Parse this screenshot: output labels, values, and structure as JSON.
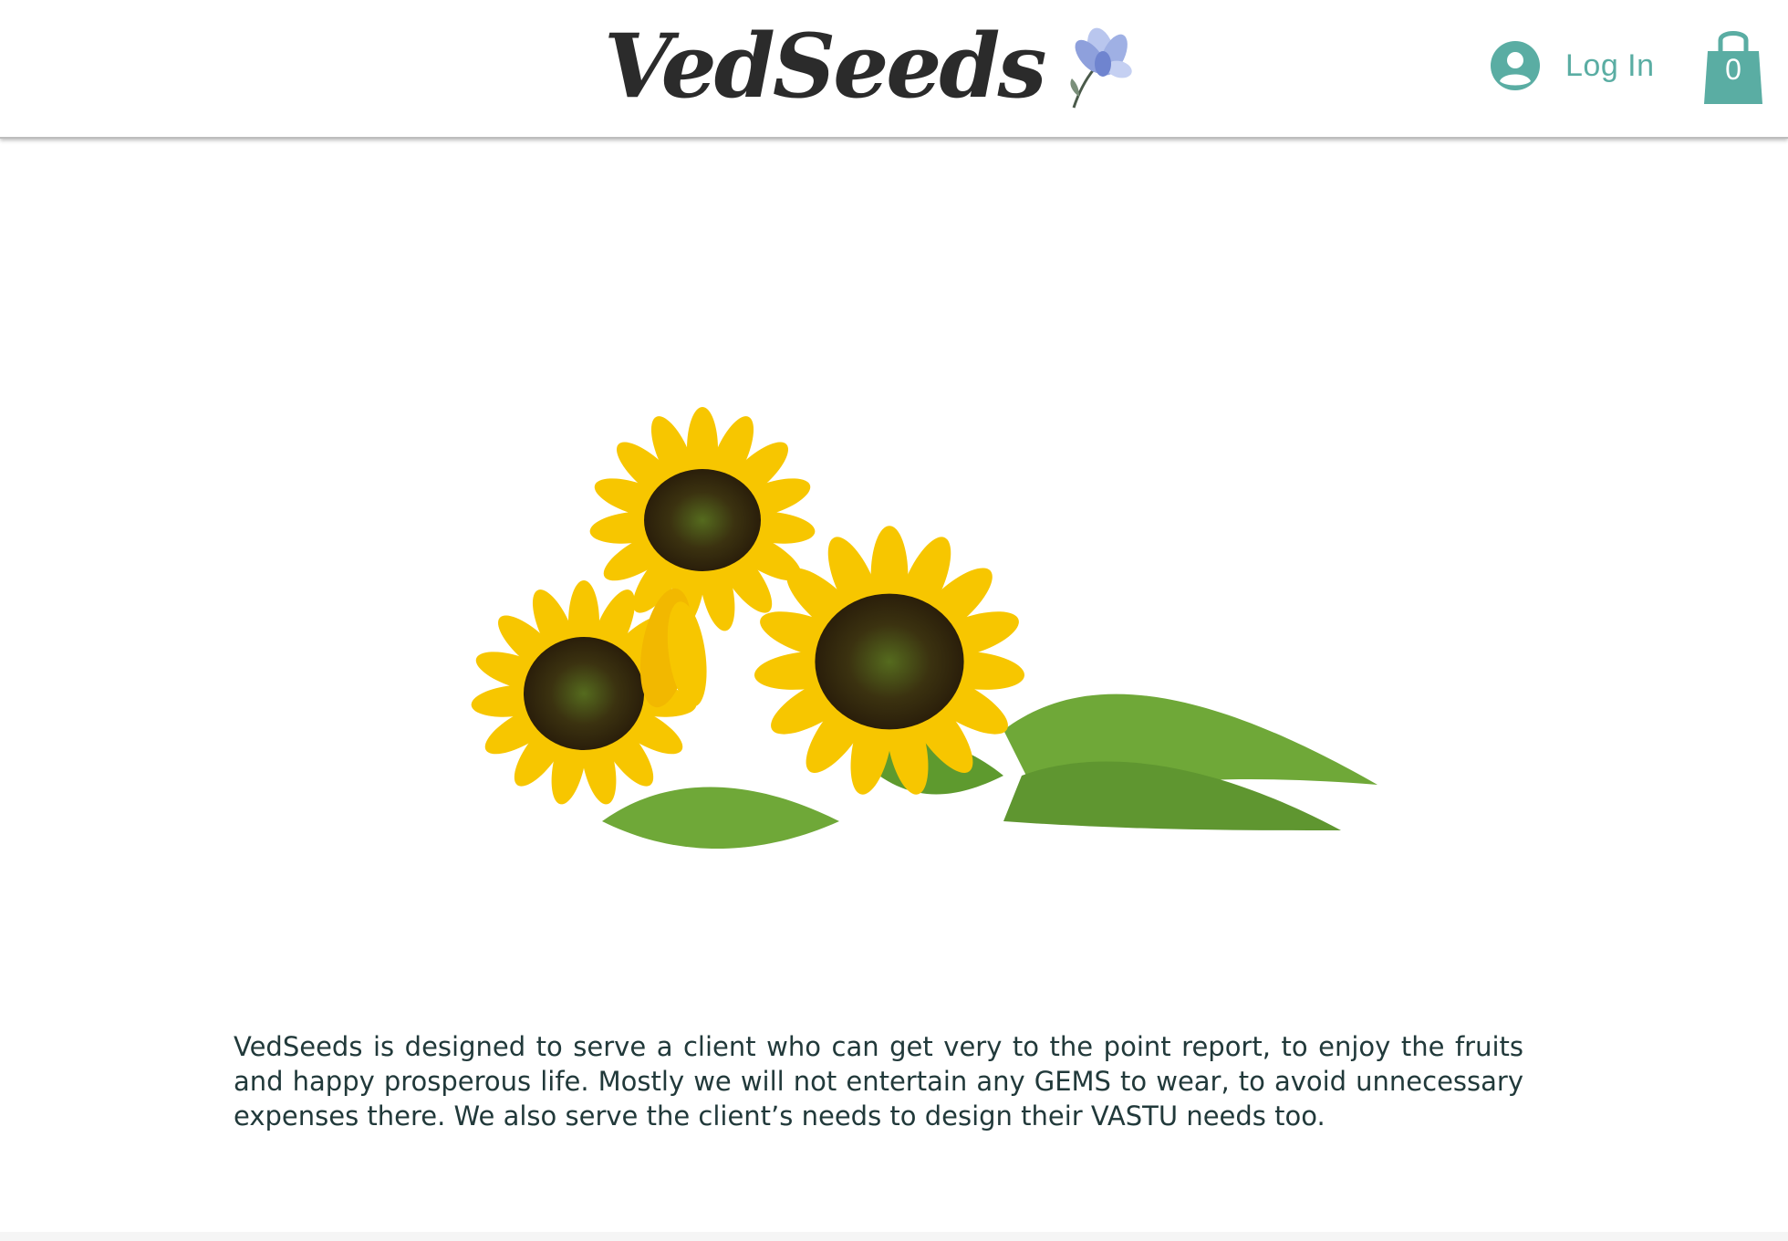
{
  "header": {
    "brand": "VedSeeds",
    "login_label": "Log In",
    "cart_count": "0"
  },
  "main": {
    "description": "VedSeeds is designed to serve a client who can get very to the point report, to enjoy the fruits and happy prosperous life. Mostly we will not entertain any GEMS to wear, to avoid unnecessary expenses there. We also serve the client’s needs to design their VASTU needs too."
  },
  "icons": {
    "logo_flower": "blue-flower-icon",
    "user": "user-avatar-icon",
    "cart": "shopping-bag-icon"
  },
  "colors": {
    "accent": "#5aada3",
    "text": "#21393a",
    "logo": "#2b2b2b",
    "petal": "#f7c600",
    "leaf": "#6fa838"
  }
}
